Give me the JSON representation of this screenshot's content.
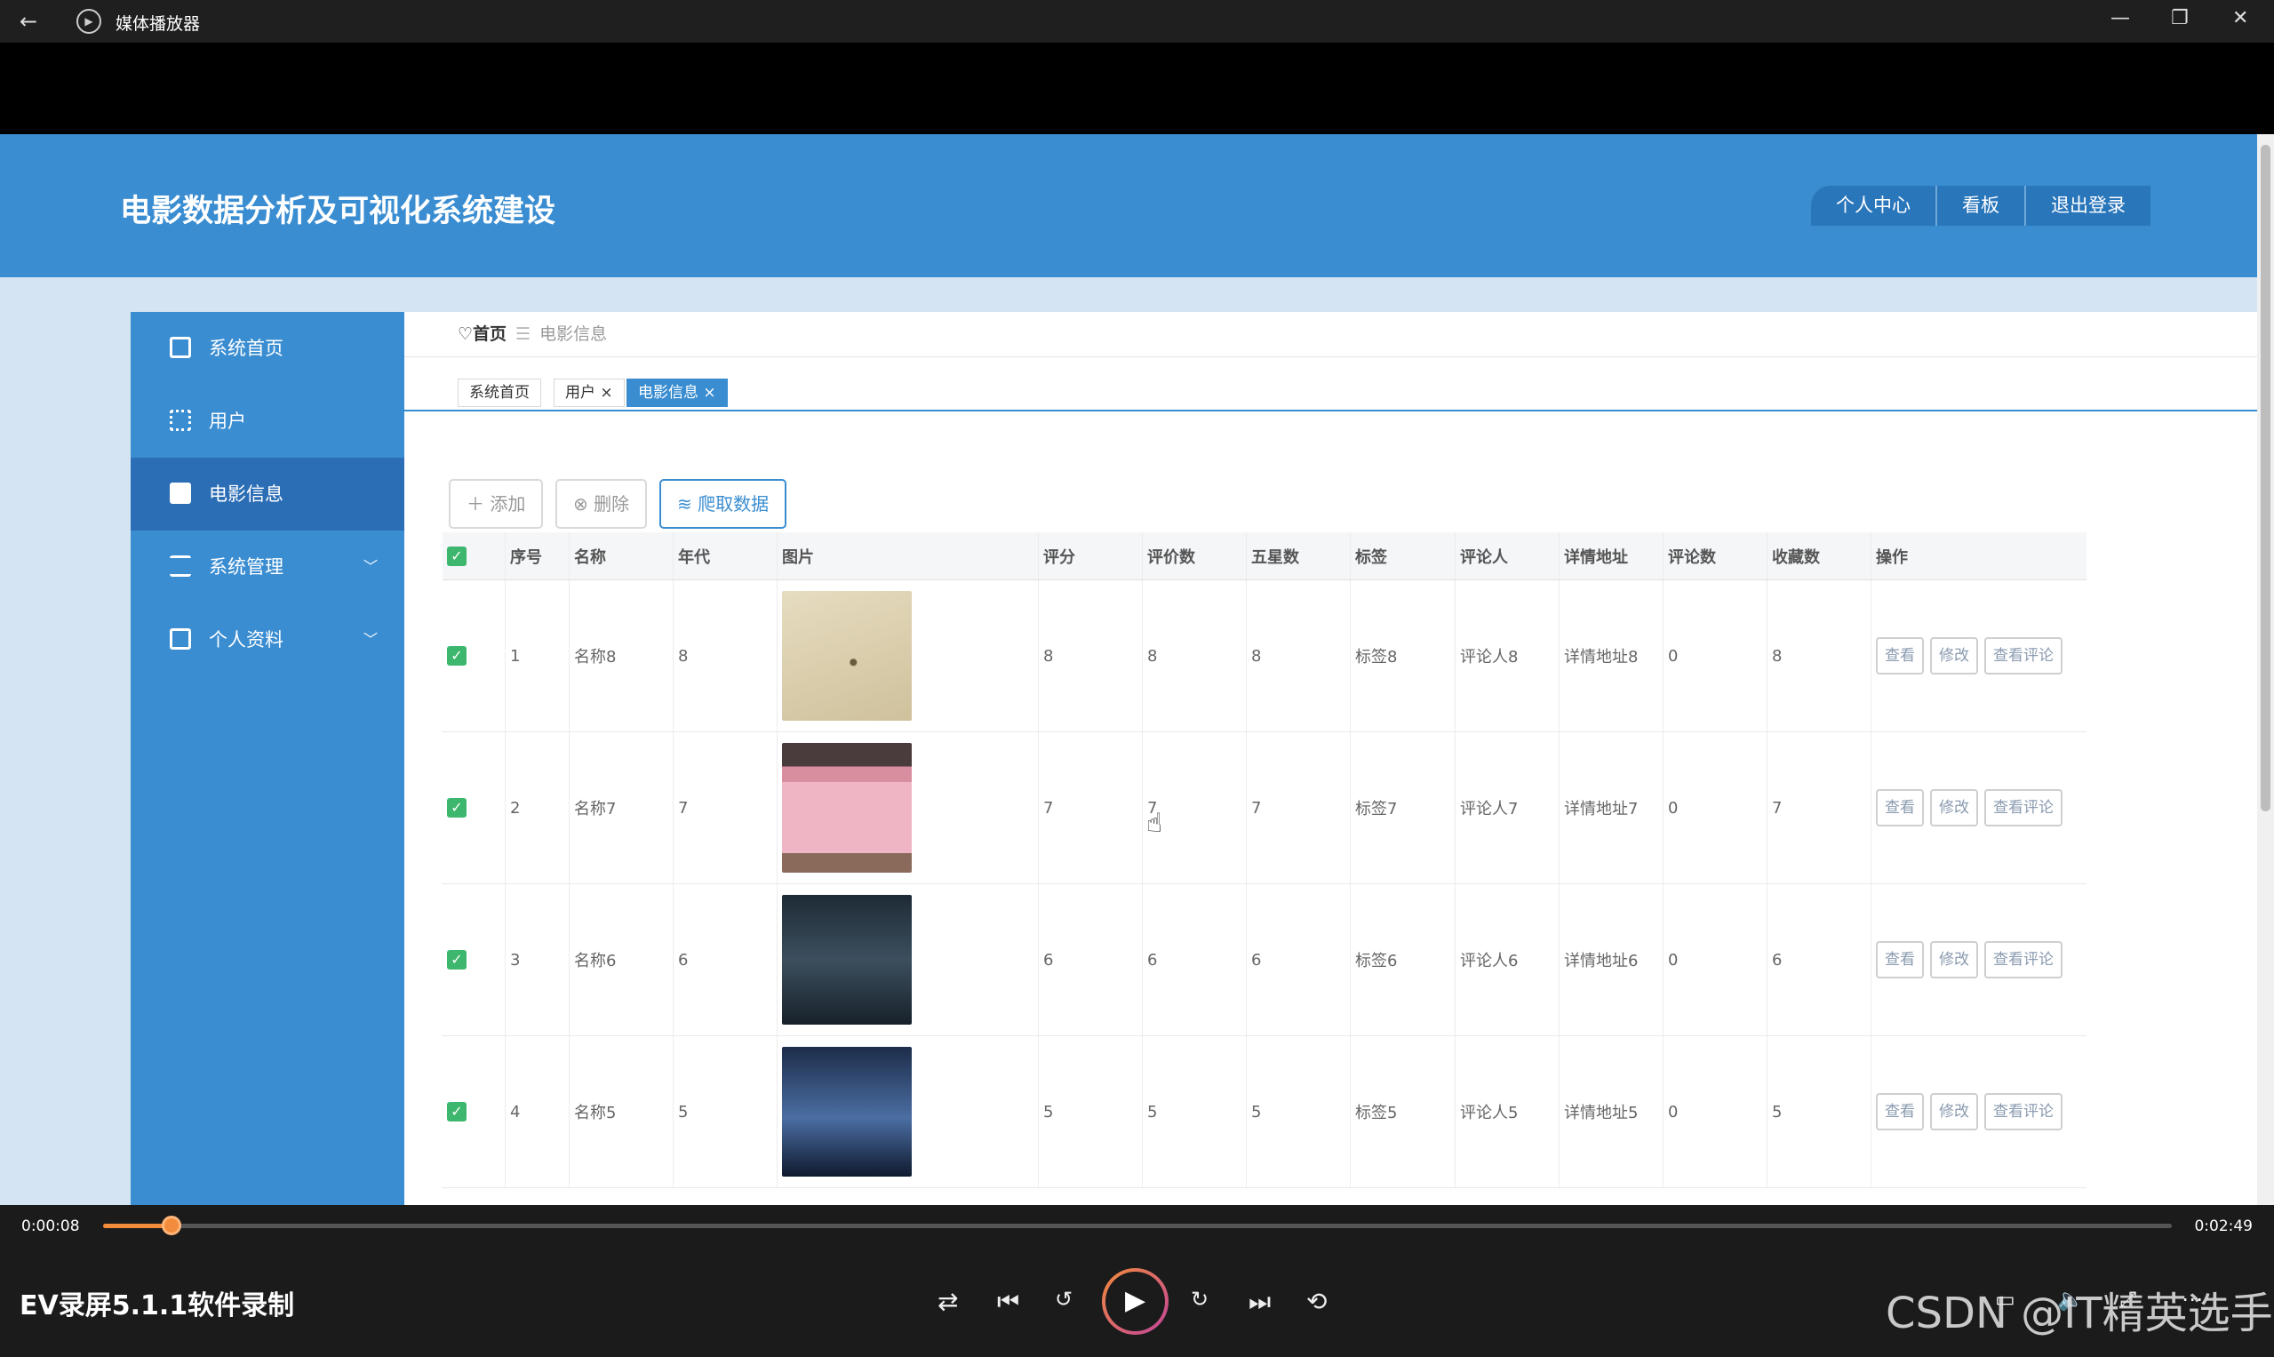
{
  "window": {
    "title": "媒体播放器",
    "back": "←",
    "minimize": "—",
    "maximize": "❐",
    "close": "✕"
  },
  "app": {
    "title": "电影数据分析及可视化系统建设",
    "topnav": [
      "个人中心",
      "看板",
      "退出登录"
    ]
  },
  "sidebar": {
    "items": [
      {
        "label": "系统首页",
        "icon": "home-icon"
      },
      {
        "label": "用户",
        "icon": "grid-icon"
      },
      {
        "label": "电影信息",
        "icon": "briefcase-icon",
        "active": true
      },
      {
        "label": "系统管理",
        "icon": "list-icon",
        "expandable": true
      },
      {
        "label": "个人资料",
        "icon": "card-icon",
        "expandable": true
      }
    ]
  },
  "breadcrumb": {
    "home": "♡首页",
    "sep": "☰",
    "current": "电影信息"
  },
  "tabs": [
    "系统首页",
    "用户 ×",
    "电影信息 ×"
  ],
  "toolbar": {
    "add": "＋ 添加",
    "delete": "⊗ 删除",
    "crawl": "≋ 爬取数据"
  },
  "table": {
    "headers": [
      "序号",
      "名称",
      "年代",
      "图片",
      "评分",
      "评价数",
      "五星数",
      "标签",
      "评论人",
      "详情地址",
      "评论数",
      "收藏数",
      "操作"
    ],
    "rows": [
      {
        "idx": "1",
        "name": "名称8",
        "year": "8",
        "score": "8",
        "reviews": "8",
        "five": "8",
        "tag": "标签8",
        "reviewer": "评论人8",
        "url": "详情地址8",
        "comments": "0",
        "favs": "8",
        "poster": "sand"
      },
      {
        "idx": "2",
        "name": "名称7",
        "year": "7",
        "score": "7",
        "reviews": "7",
        "five": "7",
        "tag": "标签7",
        "reviewer": "评论人7",
        "url": "详情地址7",
        "comments": "0",
        "favs": "7",
        "poster": "pink"
      },
      {
        "idx": "3",
        "name": "名称6",
        "year": "6",
        "score": "6",
        "reviews": "6",
        "five": "6",
        "tag": "标签6",
        "reviewer": "评论人6",
        "url": "详情地址6",
        "comments": "0",
        "favs": "6",
        "poster": "dark"
      },
      {
        "idx": "4",
        "name": "名称5",
        "year": "5",
        "score": "5",
        "reviews": "5",
        "five": "5",
        "tag": "标签5",
        "reviewer": "评论人5",
        "url": "详情地址5",
        "comments": "0",
        "favs": "5",
        "poster": "blue"
      }
    ],
    "actions": [
      "查看",
      "修改",
      "查看评论"
    ]
  },
  "player": {
    "current_time": "0:00:08",
    "total_time": "0:02:49",
    "progress": 0.033,
    "media_name": "EV录屏5.1.1软件录制",
    "watermark": "CSDN @IT精英选手"
  }
}
